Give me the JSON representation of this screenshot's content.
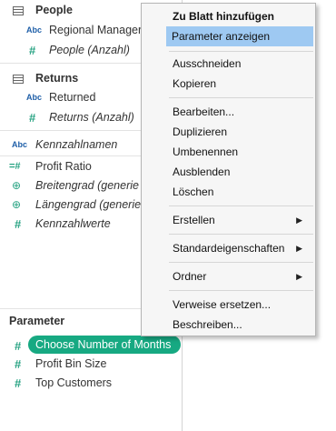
{
  "tables": [
    {
      "name": "People",
      "fields": [
        {
          "icon": "Abc",
          "label": "Regional Manager",
          "italic": false
        },
        {
          "icon": "#",
          "label": "People (Anzahl)",
          "italic": true
        }
      ]
    },
    {
      "name": "Returns",
      "fields": [
        {
          "icon": "Abc",
          "label": "Returned",
          "italic": false
        },
        {
          "icon": "#",
          "label": "Returns (Anzahl)",
          "italic": true
        }
      ]
    }
  ],
  "other_fields": [
    {
      "icon": "Abc",
      "label": "Kennzahlnamen",
      "italic": true
    },
    {
      "icon": "=#",
      "label": "Profit Ratio",
      "italic": false
    },
    {
      "icon": "globe",
      "label": "Breitengrad (generie",
      "italic": true
    },
    {
      "icon": "globe",
      "label": "Längengrad (generie",
      "italic": true
    },
    {
      "icon": "#",
      "label": "Kennzahlwerte",
      "italic": true
    }
  ],
  "parameters": {
    "header": "Parameter",
    "items": [
      {
        "label": "Choose Number of Months",
        "selected": true
      },
      {
        "label": "Profit Bin Size",
        "selected": false
      },
      {
        "label": "Top Customers",
        "selected": false
      }
    ]
  },
  "context_menu": {
    "items": [
      {
        "label": "Zu Blatt hinzufügen",
        "bold": true
      },
      {
        "label": "Parameter anzeigen",
        "highlighted": true
      },
      {
        "label": "Ausschneiden"
      },
      {
        "label": "Kopieren"
      },
      {
        "label": "Bearbeiten..."
      },
      {
        "label": "Duplizieren"
      },
      {
        "label": "Umbenennen"
      },
      {
        "label": "Ausblenden"
      },
      {
        "label": "Löschen"
      },
      {
        "label": "Erstellen",
        "submenu": true
      },
      {
        "label": "Standardeigenschaften",
        "submenu": true
      },
      {
        "label": "Ordner",
        "submenu": true
      },
      {
        "label": "Verweise ersetzen..."
      },
      {
        "label": "Beschreiben..."
      }
    ],
    "submenu_arrow": "▶"
  },
  "icons": {
    "abc": "Abc",
    "hash": "#",
    "calc_hash": "=#",
    "globe": "🌐"
  },
  "colors": {
    "parameter_pill": "#17a982",
    "menu_highlight": "#9ec9f2",
    "dimension_icon": "#1f5fa8",
    "measure_icon": "#28a383"
  }
}
